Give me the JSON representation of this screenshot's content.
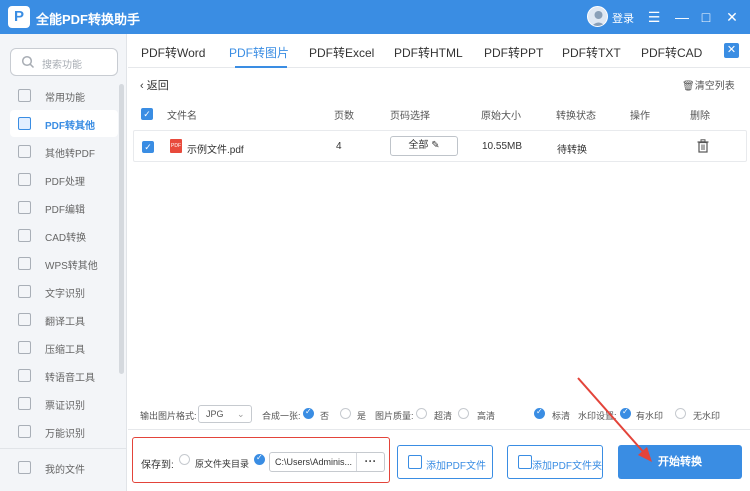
{
  "app": {
    "title": "全能PDF转换助手",
    "logo_letter": "P",
    "login_label": "登录"
  },
  "window": {
    "menu_icon": "☰",
    "minimize_icon": "—",
    "maximize_icon": "□",
    "close_icon": "✕"
  },
  "sidebar": {
    "search_placeholder": "搜索功能",
    "items": [
      {
        "label": "常用功能",
        "icon": "star-icon"
      },
      {
        "label": "PDF转其他",
        "icon": "pdf-convert-icon",
        "active": true
      },
      {
        "label": "其他转PDF",
        "icon": "to-pdf-icon"
      },
      {
        "label": "PDF处理",
        "icon": "pdf-process-icon"
      },
      {
        "label": "PDF编辑",
        "icon": "pdf-edit-icon"
      },
      {
        "label": "CAD转换",
        "icon": "cad-icon"
      },
      {
        "label": "WPS转其他",
        "icon": "wps-icon"
      },
      {
        "label": "文字识别",
        "icon": "ocr-icon"
      },
      {
        "label": "翻译工具",
        "icon": "translate-icon"
      },
      {
        "label": "压缩工具",
        "icon": "compress-icon"
      },
      {
        "label": "转语音工具",
        "icon": "voice-icon"
      },
      {
        "label": "票证识别",
        "icon": "ticket-icon"
      },
      {
        "label": "万能识别",
        "icon": "universal-icon"
      }
    ],
    "my_files": "我的文件"
  },
  "tabs": [
    {
      "label": "PDF转Word"
    },
    {
      "label": "PDF转图片",
      "active": true
    },
    {
      "label": "PDF转Excel"
    },
    {
      "label": "PDF转HTML"
    },
    {
      "label": "PDF转PPT"
    },
    {
      "label": "PDF转TXT"
    },
    {
      "label": "PDF转CAD"
    }
  ],
  "toolbar": {
    "back_label": "返回",
    "clear_label": "清空列表"
  },
  "table": {
    "headers": {
      "name": "文件名",
      "pages": "页数",
      "page_select": "页码选择",
      "size": "原始大小",
      "status": "转换状态",
      "action": "操作",
      "delete": "删除"
    },
    "rows": [
      {
        "name": "示例文件.pdf",
        "pages": "4",
        "page_select": "全部",
        "size": "10.55MB",
        "status": "待转换"
      }
    ]
  },
  "options": {
    "format_label": "输出图片格式:",
    "format_value": "JPG",
    "merge_label": "合成一张:",
    "merge_no": "否",
    "merge_yes": "是",
    "quality_label": "图片质量:",
    "quality_super": "超清",
    "quality_high": "高清",
    "quality_standard": "标清",
    "watermark_label": "水印设置:",
    "watermark_yes": "有水印",
    "watermark_no": "无水印"
  },
  "save": {
    "label": "保存到:",
    "source_dir": "原文件夹目录",
    "path": "C:\\Users\\Adminis...",
    "more": "···"
  },
  "buttons": {
    "add_file": "添加PDF文件",
    "add_folder": "添加PDF文件夹",
    "start": "开始转换"
  },
  "colors": {
    "accent": "#3a8de3",
    "highlight": "#e3443a"
  }
}
